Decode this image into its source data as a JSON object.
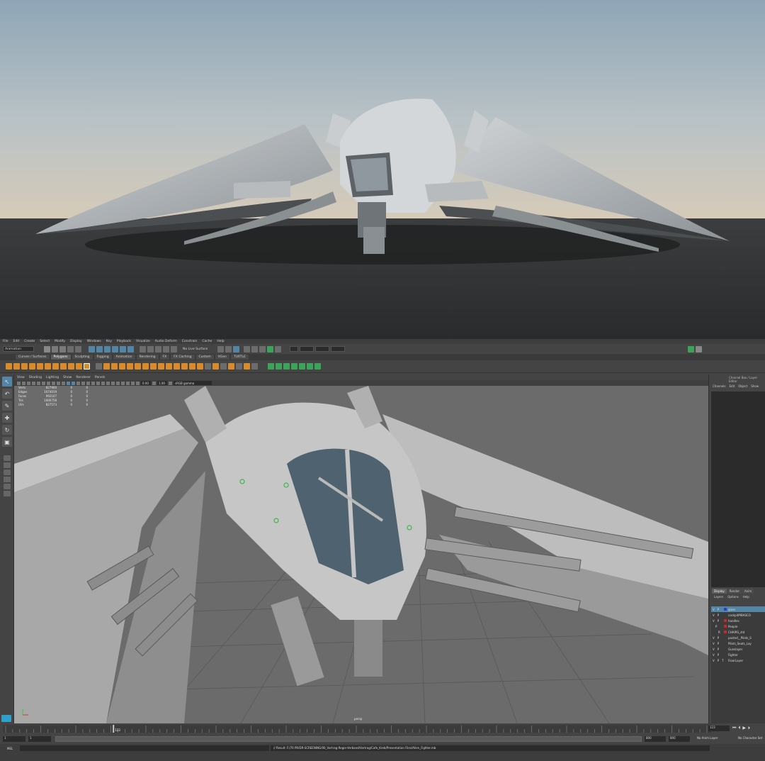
{
  "menubar": [
    "File",
    "Edit",
    "Create",
    "Select",
    "Modify",
    "Display",
    "Windows",
    "Key",
    "Playback",
    "Visualize",
    "Audio Deform",
    "Constrain",
    "Cache",
    "Help"
  ],
  "statusline": {
    "mode": "Animation",
    "live_surface": "No Live Surface"
  },
  "shelf_tabs": [
    {
      "label": "Curves / Surfaces",
      "active": false
    },
    {
      "label": "Polygons",
      "active": true
    },
    {
      "label": "Sculpting",
      "active": false
    },
    {
      "label": "Rigging",
      "active": false
    },
    {
      "label": "Animation",
      "active": false
    },
    {
      "label": "Rendering",
      "active": false
    },
    {
      "label": "FX",
      "active": false
    },
    {
      "label": "FX Caching",
      "active": false
    },
    {
      "label": "Custom",
      "active": false
    },
    {
      "label": "XGen",
      "active": false
    },
    {
      "label": "TURTLE",
      "active": false
    }
  ],
  "viewport_menu": [
    "View",
    "Shading",
    "Lighting",
    "Show",
    "Renderer",
    "Panels"
  ],
  "viewport_toolbar": {
    "exposure": "0.00",
    "gamma": "1.00",
    "color_space": "sRGB gamma"
  },
  "hud": [
    {
      "label": "Verts",
      "value": "827900",
      "a": "0",
      "b": "0"
    },
    {
      "label": "Edges",
      "value": "1674019",
      "a": "0",
      "b": "0"
    },
    {
      "label": "Faces",
      "value": "992107",
      "a": "0",
      "b": "0"
    },
    {
      "label": "Tris",
      "value": "1666758",
      "a": "0",
      "b": "0"
    },
    {
      "label": "UVs",
      "value": "827573",
      "a": "0",
      "b": "0"
    }
  ],
  "camera_label": "persp",
  "channel_box": {
    "title": "Channel Box / Layer Editor",
    "menu": [
      "Channels",
      "Edit",
      "Object",
      "Show"
    ]
  },
  "layer_editor": {
    "tabs": [
      {
        "label": "Display",
        "active": true
      },
      {
        "label": "Render",
        "active": false
      },
      {
        "label": "Anim",
        "active": false
      }
    ],
    "menu": [
      "Layers",
      "Options",
      "Help"
    ],
    "layers": [
      {
        "v": "V",
        "p": "P",
        "t": "",
        "color": "#2b3bd6",
        "name": "glass",
        "selected": true
      },
      {
        "v": "V",
        "p": "P",
        "t": "",
        "color": "",
        "name": "cockpitPIBASCO",
        "selected": false
      },
      {
        "v": "V",
        "p": "P",
        "t": "",
        "color": "#c42a2a",
        "name": "handles",
        "selected": false
      },
      {
        "v": "",
        "p": "P",
        "t": "",
        "color": "#c42a2a",
        "name": "People",
        "selected": false
      },
      {
        "v": "",
        "p": "",
        "t": "R",
        "color": "#c42a2a",
        "name": "CHAIRS_std",
        "selected": false
      },
      {
        "v": "V",
        "p": "P",
        "t": "",
        "color": "",
        "name": "pasted__Pilots_S",
        "selected": false
      },
      {
        "v": "V",
        "p": "P",
        "t": "",
        "color": "",
        "name": "Pilots_Seats_Lay",
        "selected": false
      },
      {
        "v": "V",
        "p": "P",
        "t": "",
        "color": "",
        "name": "Gunslayer",
        "selected": false
      },
      {
        "v": "V",
        "p": "P",
        "t": "",
        "color": "",
        "name": "Fighter",
        "selected": false
      },
      {
        "v": "V",
        "p": "P",
        "t": "T",
        "color": "",
        "name": "FloorLayer",
        "selected": false
      }
    ]
  },
  "timeline": {
    "current_frame": "123",
    "frame_field": "123"
  },
  "range": {
    "start": "1",
    "start_inner": "1",
    "end_inner": "800",
    "end": "800",
    "end2": "800",
    "anim_layer": "No Anim Layer",
    "char_set": "No Character Set"
  },
  "command_line": {
    "label": "MEL",
    "result": "// Result: F:/70 PR/DR-SCREENING/00_Vortrag-Regie-Verband/Vortrag/Cafe_Kreb/Presentation Files/Alien_Fighter.mb"
  }
}
